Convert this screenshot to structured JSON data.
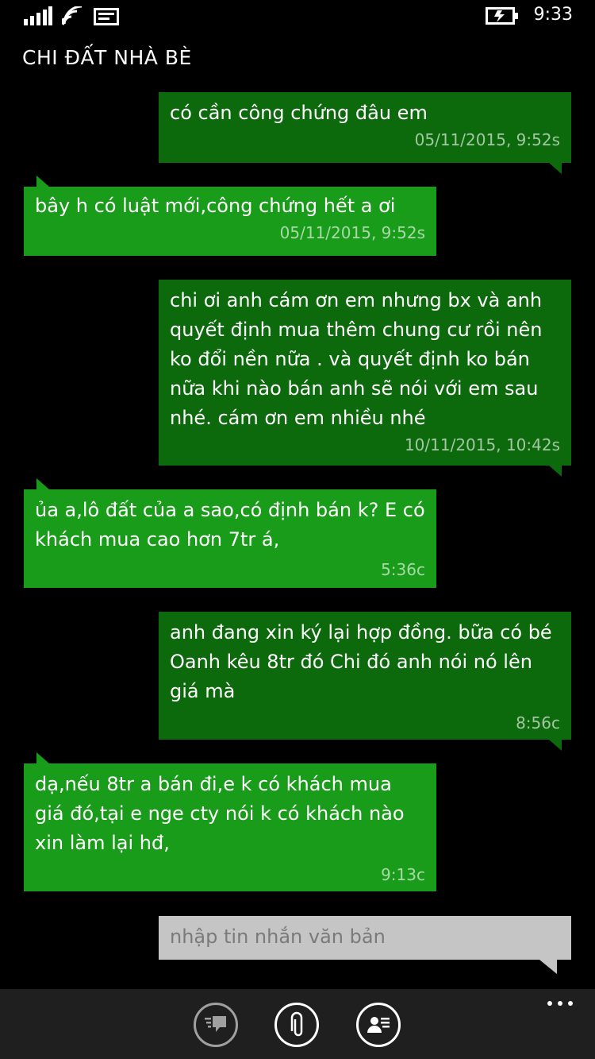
{
  "status_bar": {
    "time": "9:33",
    "icons": [
      "signal-icon",
      "wifi-icon",
      "message-icon",
      "battery-charging-icon"
    ]
  },
  "header": {
    "title": "CHI ĐẤT NHÀ BÈ"
  },
  "messages": [
    {
      "direction": "out",
      "text": "có cần công chứng đâu em",
      "time": "05/11/2015, 9:52s"
    },
    {
      "direction": "in",
      "text": "bây h có luật mới,công chứng hết a ơi",
      "time": "05/11/2015, 9:52s"
    },
    {
      "direction": "out",
      "text": "chi ơi anh cám ơn em nhưng bx và anh quyết định mua thêm chung cư rồi nên ko đổi nền nữa . và quyết định ko bán nữa khi nào bán anh sẽ nói với em sau nhé. cám ơn em nhiều nhé",
      "time": "10/11/2015, 10:42s"
    },
    {
      "direction": "in",
      "text": "ủa a,lô đất của a sao,có định bán k? E có khách mua cao hơn 7tr á,",
      "time": "5:36c"
    },
    {
      "direction": "out",
      "text": "anh đang xin ký lại hợp đồng. bữa có bé Oanh kêu 8tr đó Chi đó anh nói nó lên giá mà",
      "time": "8:56c"
    },
    {
      "direction": "in",
      "text": "dạ,nếu 8tr a bán đi,e k có khách mua giá đó,tại e nge cty nói k có khách nào xin làm lại hđ,",
      "time": "9:13c"
    }
  ],
  "compose": {
    "placeholder": "nhập tin nhắn văn bản"
  },
  "app_bar": {
    "buttons": [
      "switch-conversation-icon",
      "attach-icon",
      "contact-card-icon"
    ],
    "more": "more-icon"
  },
  "colors": {
    "outgoing_bubble": "#0c6a0c",
    "incoming_bubble": "#199c19",
    "compose_box": "#c5c5c5",
    "app_bar": "#1f1f1f"
  }
}
